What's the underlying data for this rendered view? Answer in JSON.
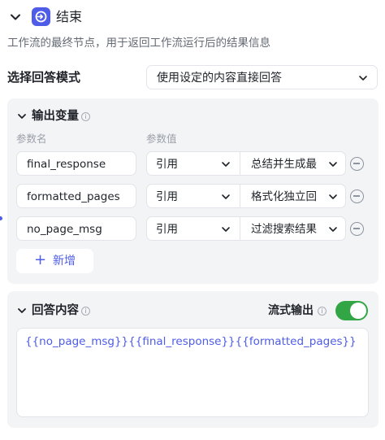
{
  "node": {
    "title": "结束",
    "description": "工作流的最终节点，用于返回工作流运行后的结果信息",
    "icon": "end-node-icon"
  },
  "answer_mode": {
    "label": "选择回答模式",
    "selected": "使用设定的内容直接回答"
  },
  "output_variables": {
    "title": "输出变量",
    "info_icon": "info-icon",
    "col_name": "参数名",
    "col_value": "参数值",
    "rows": [
      {
        "name": "final_response",
        "type": "引用",
        "source": "总结并生成最"
      },
      {
        "name": "formatted_pages",
        "type": "引用",
        "source": "格式化独立回"
      },
      {
        "name": "no_page_msg",
        "type": "引用",
        "source": "过滤搜索结果"
      }
    ],
    "add_label": "新增"
  },
  "answer_content": {
    "title": "回答内容",
    "stream_label": "流式输出",
    "stream_enabled": true,
    "content": "{{no_page_msg}}{{final_response}}{{formatted_pages}}"
  },
  "colors": {
    "accent": "#4e5ce8",
    "toggle_on": "#32a645",
    "panel_bg": "#f3f4f6"
  }
}
